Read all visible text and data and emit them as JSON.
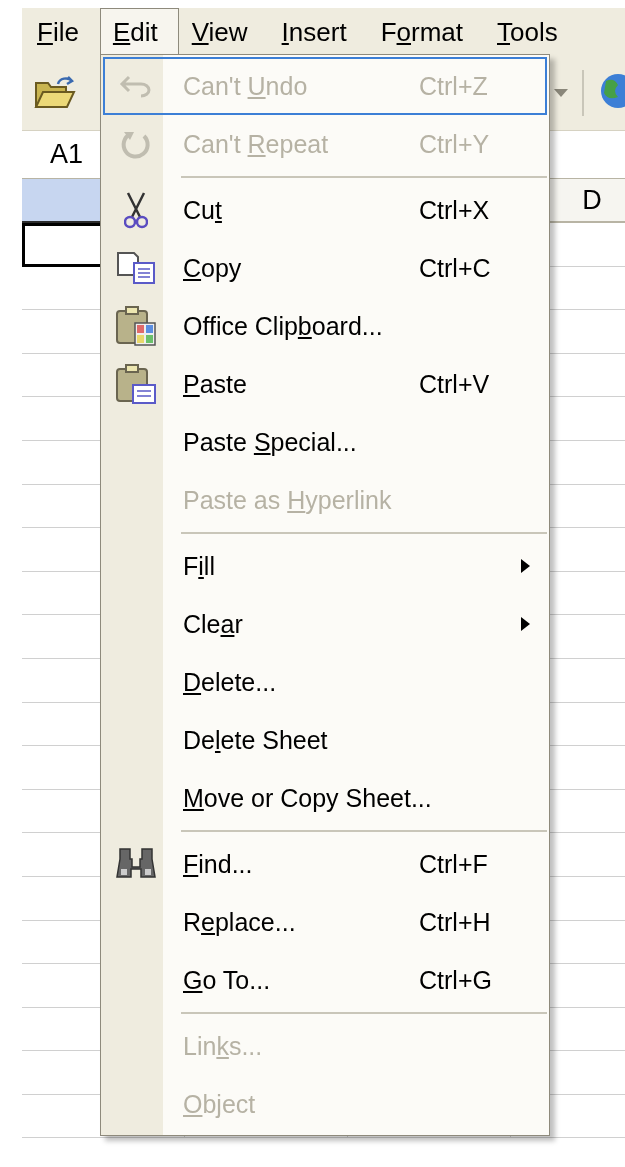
{
  "menu_bar": [
    {
      "label": {
        "key": "F",
        "after": "ile"
      },
      "selected": false
    },
    {
      "label": {
        "key": "E",
        "after": "dit"
      },
      "selected": true
    },
    {
      "label": {
        "key": "V",
        "after": "iew"
      },
      "selected": false
    },
    {
      "label": {
        "key": "I",
        "after": "nsert"
      },
      "selected": false
    },
    {
      "label": {
        "before": "F",
        "key": "o",
        "after": "rmat"
      },
      "selected": false
    },
    {
      "label": {
        "key": "T",
        "after": "ools"
      },
      "selected": false
    }
  ],
  "name_box": "A1",
  "column_headers": [
    {
      "selected": true
    },
    {
      "label": "D",
      "selected": false
    }
  ],
  "edit_menu": [
    {
      "kind": "item",
      "label": {
        "before": "Can't ",
        "key": "U",
        "after": "ndo"
      },
      "shortcut": "Ctrl+Z",
      "disabled": true,
      "selected": true
    },
    {
      "kind": "item",
      "label": {
        "before": "Can't ",
        "key": "R",
        "after": "epeat"
      },
      "shortcut": "Ctrl+Y",
      "disabled": true,
      "selected": false
    },
    {
      "kind": "separator"
    },
    {
      "kind": "item",
      "label": {
        "before": "Cu",
        "key": "t"
      },
      "shortcut": "Ctrl+X",
      "disabled": false,
      "selected": false
    },
    {
      "kind": "item",
      "label": {
        "key": "C",
        "after": "opy"
      },
      "shortcut": "Ctrl+C",
      "disabled": false,
      "selected": false
    },
    {
      "kind": "item",
      "label": {
        "before": "Office Clip",
        "key": "b",
        "after": "oard..."
      },
      "disabled": false,
      "selected": false
    },
    {
      "kind": "item",
      "label": {
        "key": "P",
        "after": "aste"
      },
      "shortcut": "Ctrl+V",
      "disabled": false,
      "selected": false
    },
    {
      "kind": "item",
      "label": {
        "before": "Paste ",
        "key": "S",
        "after": "pecial..."
      },
      "disabled": false,
      "selected": false
    },
    {
      "kind": "item",
      "label": {
        "before": "Paste as ",
        "key": "H",
        "after": "yperlink"
      },
      "disabled": true,
      "selected": false
    },
    {
      "kind": "separator"
    },
    {
      "kind": "submenu",
      "label": {
        "before": "F",
        "key": "i",
        "after": "ll"
      },
      "disabled": false,
      "selected": false
    },
    {
      "kind": "submenu",
      "label": {
        "before": "Cle",
        "key": "a",
        "after": "r"
      },
      "disabled": false,
      "selected": false
    },
    {
      "kind": "item",
      "label": {
        "key": "D",
        "after": "elete..."
      },
      "disabled": false,
      "selected": false
    },
    {
      "kind": "item",
      "label": {
        "before": "De",
        "key": "l",
        "after": "ete Sheet"
      },
      "disabled": false,
      "selected": false
    },
    {
      "kind": "item",
      "label": {
        "key": "M",
        "after": "ove or Copy Sheet..."
      },
      "disabled": false,
      "selected": false
    },
    {
      "kind": "separator"
    },
    {
      "kind": "item",
      "label": {
        "key": "F",
        "after": "ind..."
      },
      "shortcut": "Ctrl+F",
      "disabled": false,
      "selected": false
    },
    {
      "kind": "item",
      "label": {
        "before": "R",
        "key": "e",
        "after": "place..."
      },
      "shortcut": "Ctrl+H",
      "disabled": false,
      "selected": false
    },
    {
      "kind": "item",
      "label": {
        "key": "G",
        "after": "o To..."
      },
      "shortcut": "Ctrl+G",
      "disabled": false,
      "selected": false
    },
    {
      "kind": "separator"
    },
    {
      "kind": "item",
      "label": {
        "before": "Lin",
        "key": "k",
        "after": "s..."
      },
      "disabled": true,
      "selected": false
    },
    {
      "kind": "item",
      "label": {
        "key": "O",
        "after": "bject"
      },
      "disabled": true,
      "selected": false
    }
  ]
}
